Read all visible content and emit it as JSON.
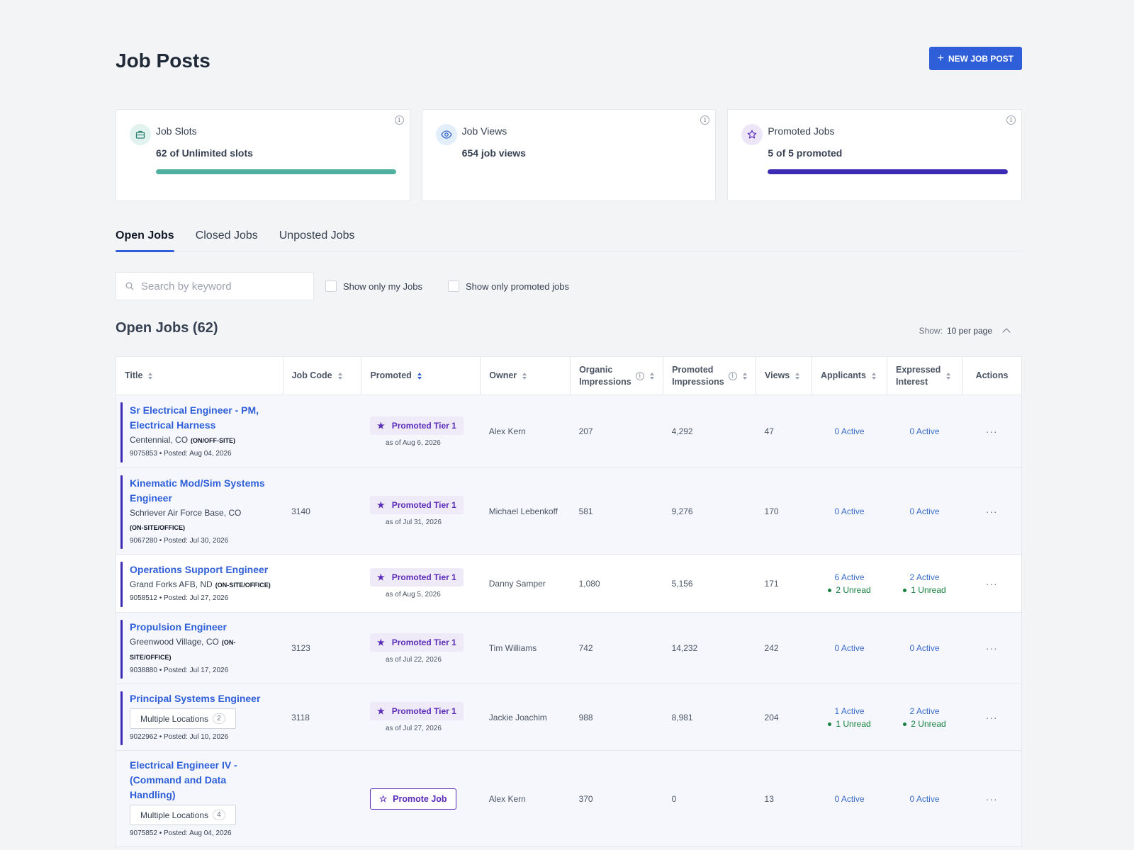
{
  "page": {
    "title": "Job Posts",
    "new_button": "NEW JOB POST"
  },
  "cards": [
    {
      "title": "Job Slots",
      "value": "62 of Unlimited slots",
      "icon": "briefcase-icon",
      "bar_color": "#4fb0a0",
      "bar_fill": 1.0
    },
    {
      "title": "Job Views",
      "value": "654 job views",
      "icon": "eye-icon"
    },
    {
      "title": "Promoted Jobs",
      "value": "5 of 5 promoted",
      "icon": "star-icon",
      "bar_color": "#3b2bb5",
      "bar_fill": 1.0
    }
  ],
  "tabs": [
    "Open Jobs",
    "Closed Jobs",
    "Unposted Jobs"
  ],
  "filters": {
    "search_placeholder": "Search by keyword",
    "check_my": "Show only my Jobs",
    "check_promoted": "Show only promoted jobs"
  },
  "list": {
    "title": "Open Jobs (62)",
    "show_label": "Show:",
    "show_value": "10 per page"
  },
  "columns": {
    "title": "Title",
    "job_code": "Job Code",
    "promoted": "Promoted",
    "owner": "Owner",
    "organic_1": "Organic",
    "organic_2": "Impressions",
    "promoted_imp_1": "Promoted",
    "promoted_imp_2": "Impressions",
    "views": "Views",
    "applicants": "Applicants",
    "interest_1": "Expressed",
    "interest_2": "Interest",
    "actions": "Actions"
  },
  "rows": [
    {
      "title": "Sr Electrical Engineer - PM, Electrical Harness",
      "location": "Centennial, CO",
      "mode": "(ON/OFF-SITE)",
      "meta": "9075853 • Posted: Aug 04, 2026",
      "job_code": "",
      "promoted": "Promoted Tier 1",
      "promoted_date": "as of Aug 6, 2026",
      "owner": "Alex Kern",
      "organic": "207",
      "promoted_imp": "4,292",
      "views": "47",
      "applicants_active": "0 Active",
      "applicants_unread": "",
      "interest_active": "0 Active",
      "interest_unread": ""
    },
    {
      "title": "Kinematic Mod/Sim Systems Engineer",
      "location": "Schriever Air Force Base, CO",
      "mode": "(ON-SITE/OFFICE)",
      "meta": "9067280 • Posted: Jul 30, 2026",
      "job_code": "3140",
      "promoted": "Promoted Tier 1",
      "promoted_date": "as of Jul 31, 2026",
      "owner": "Michael Lebenkoff",
      "organic": "581",
      "promoted_imp": "9,276",
      "views": "170",
      "applicants_active": "0 Active",
      "applicants_unread": "",
      "interest_active": "0 Active",
      "interest_unread": ""
    },
    {
      "title": "Operations Support Engineer",
      "location": "Grand Forks AFB, ND",
      "mode": "(ON-SITE/OFFICE)",
      "meta": "9058512 • Posted: Jul 27, 2026",
      "job_code": "",
      "promoted": "Promoted Tier 1",
      "promoted_date": "as of Aug 5, 2026",
      "owner": "Danny Samper",
      "organic": "1,080",
      "promoted_imp": "5,156",
      "views": "171",
      "applicants_active": "6 Active",
      "applicants_unread": "2 Unread",
      "interest_active": "2 Active",
      "interest_unread": "1 Unread"
    },
    {
      "title": "Propulsion Engineer",
      "location": "Greenwood Village, CO",
      "mode": "(ON-SITE/OFFICE)",
      "meta": "9038880 • Posted: Jul 17, 2026",
      "job_code": "3123",
      "promoted": "Promoted Tier 1",
      "promoted_date": "as of Jul 22, 2026",
      "owner": "Tim Williams",
      "organic": "742",
      "promoted_imp": "14,232",
      "views": "242",
      "applicants_active": "0 Active",
      "applicants_unread": "",
      "interest_active": "0 Active",
      "interest_unread": ""
    },
    {
      "title": "Principal Systems Engineer",
      "multi_label": "Multiple Locations",
      "multi_count": "2",
      "meta": "9022962 • Posted: Jul 10, 2026",
      "job_code": "3118",
      "promoted": "Promoted Tier 1",
      "promoted_date": "as of Jul 27, 2026",
      "owner": "Jackie Joachim",
      "organic": "988",
      "promoted_imp": "8,981",
      "views": "204",
      "applicants_active": "1 Active",
      "applicants_unread": "1 Unread",
      "interest_active": "2 Active",
      "interest_unread": "2 Unread"
    },
    {
      "title": "Electrical Engineer IV - (Command and Data Handling)",
      "multi_label": "Multiple Locations",
      "multi_count": "4",
      "meta": "9075852 • Posted: Aug 04, 2026",
      "job_code": "",
      "promote_button": "Promote Job",
      "owner": "Alex Kern",
      "organic": "370",
      "promoted_imp": "0",
      "views": "13",
      "applicants_active": "0 Active",
      "applicants_unread": "",
      "interest_active": "0 Active",
      "interest_unread": ""
    }
  ],
  "colors": {
    "accent": "#2f5fd8",
    "promo": "#5b2cb8",
    "unread": "#15803d"
  }
}
